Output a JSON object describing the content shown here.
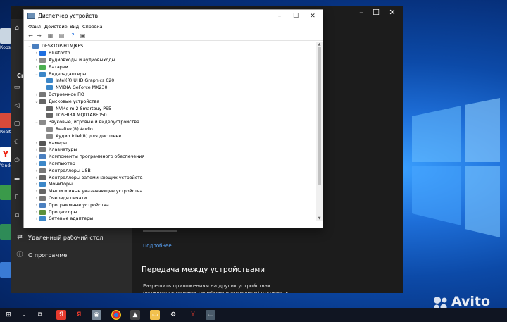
{
  "device_manager": {
    "title": "Диспетчер устройств",
    "menu": [
      "Файл",
      "Действие",
      "Вид",
      "Справка"
    ],
    "tree": [
      {
        "label": "DESKTOP-H1MJKPS",
        "level": 0,
        "expander": "⌄",
        "icon_color": "#4a7fbf"
      },
      {
        "label": "Bluetooth",
        "level": 1,
        "expander": "›",
        "icon_color": "#1f6fe0"
      },
      {
        "label": "Аудиовходы и аудиовыходы",
        "level": 1,
        "expander": "›",
        "icon_color": "#8a8a8a"
      },
      {
        "label": "Батареи",
        "level": 1,
        "expander": "›",
        "icon_color": "#4caf50"
      },
      {
        "label": "Видеоадаптеры",
        "level": 1,
        "expander": "⌄",
        "icon_color": "#3c87c8"
      },
      {
        "label": "Intel(R) UHD Graphics 620",
        "level": 2,
        "expander": "",
        "icon_color": "#3c87c8"
      },
      {
        "label": "NVIDIA GeForce MX230",
        "level": 2,
        "expander": "",
        "icon_color": "#3c87c8"
      },
      {
        "label": "Встроенное ПО",
        "level": 1,
        "expander": "›",
        "icon_color": "#777777"
      },
      {
        "label": "Дисковые устройства",
        "level": 1,
        "expander": "⌄",
        "icon_color": "#666666"
      },
      {
        "label": "NVMe m.2 Smartbuy PS5",
        "level": 2,
        "expander": "",
        "icon_color": "#666666"
      },
      {
        "label": "TOSHIBA MQ01ABF050",
        "level": 2,
        "expander": "",
        "icon_color": "#666666"
      },
      {
        "label": "Звуковые, игровые и видеоустройства",
        "level": 1,
        "expander": "⌄",
        "icon_color": "#8a8a8a"
      },
      {
        "label": "Realtek(R) Audio",
        "level": 2,
        "expander": "",
        "icon_color": "#8a8a8a"
      },
      {
        "label": "Аудио Intel(R) для дисплеев",
        "level": 2,
        "expander": "",
        "icon_color": "#8a8a8a"
      },
      {
        "label": "Камеры",
        "level": 1,
        "expander": "›",
        "icon_color": "#555555"
      },
      {
        "label": "Клавиатуры",
        "level": 1,
        "expander": "›",
        "icon_color": "#777777"
      },
      {
        "label": "Компоненты программного обеспечения",
        "level": 1,
        "expander": "›",
        "icon_color": "#4a7fbf"
      },
      {
        "label": "Компьютер",
        "level": 1,
        "expander": "›",
        "icon_color": "#3c87c8"
      },
      {
        "label": "Контроллеры USB",
        "level": 1,
        "expander": "›",
        "icon_color": "#777777"
      },
      {
        "label": "Контроллеры запоминающих устройств",
        "level": 1,
        "expander": "›",
        "icon_color": "#666666"
      },
      {
        "label": "Мониторы",
        "level": 1,
        "expander": "›",
        "icon_color": "#3c87c8"
      },
      {
        "label": "Мыши и иные указывающие устройства",
        "level": 1,
        "expander": "›",
        "icon_color": "#666666"
      },
      {
        "label": "Очереди печати",
        "level": 1,
        "expander": "›",
        "icon_color": "#777777"
      },
      {
        "label": "Программные устройства",
        "level": 1,
        "expander": "›",
        "icon_color": "#4a7fbf"
      },
      {
        "label": "Процессоры",
        "level": 1,
        "expander": "›",
        "icon_color": "#5a8f3a"
      },
      {
        "label": "Сетевые адаптеры",
        "level": 1,
        "expander": "›",
        "icon_color": "#3c87c8"
      }
    ]
  },
  "settings": {
    "sidebar": [
      {
        "label": "Удаленный рабочий стол",
        "icon": "remote-desktop-icon",
        "glyph": "⇄"
      },
      {
        "label": "О программе",
        "icon": "info-icon",
        "glyph": "ⓘ"
      }
    ],
    "sidebar_partial_heading": "Си",
    "more_link": "Подробнее",
    "section_heading": "Передача между устройствами",
    "section_body": "Разрешить приложениям на других устройствах (включая связанные телефоны и планшеты) открывать приложения и"
  },
  "desktop": {
    "icon_labels": [
      "Корз",
      "Realte",
      "Yande"
    ]
  },
  "watermark": "Avito"
}
